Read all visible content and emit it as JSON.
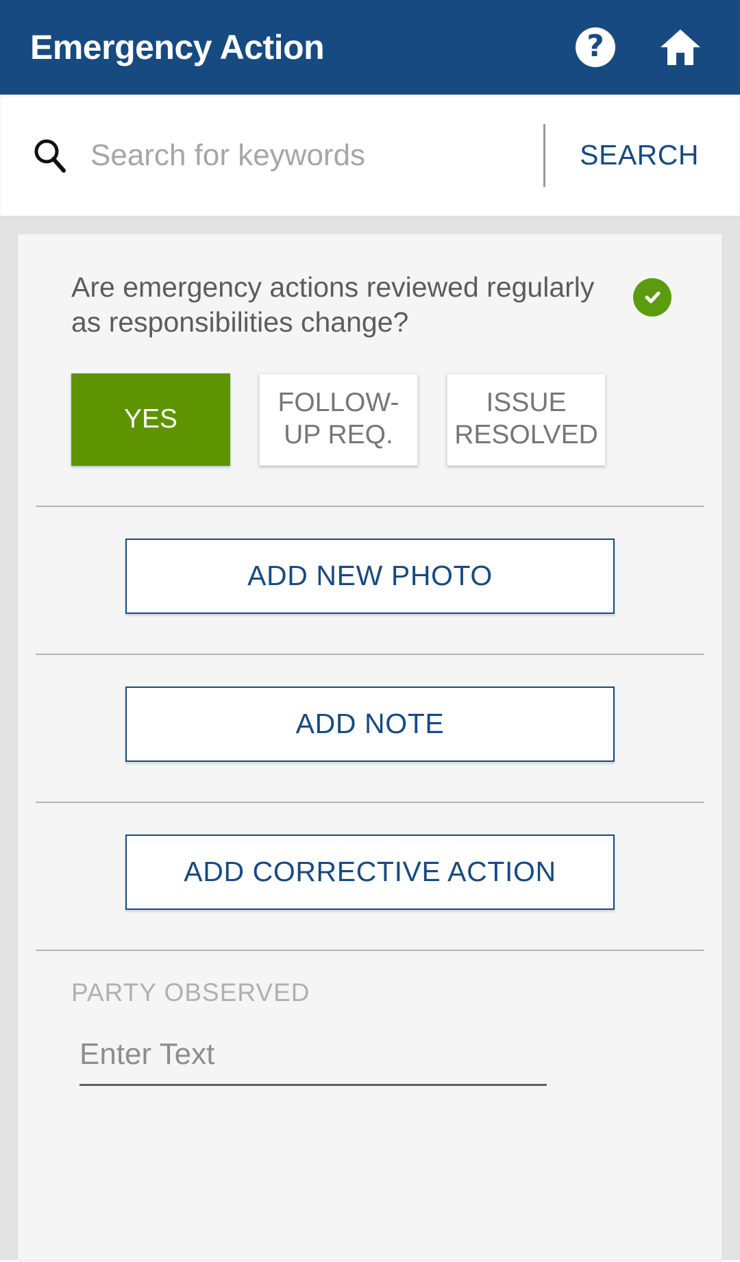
{
  "appbar": {
    "title": "Emergency Action",
    "help_icon": "help-circle-icon",
    "home_icon": "home-icon"
  },
  "search": {
    "icon": "search-icon",
    "placeholder": "Search for keywords",
    "value": "",
    "button_label": "SEARCH"
  },
  "card": {
    "question": "Are emergency actions reviewed regularly as responsibilities change?",
    "status_badge": {
      "icon": "check-icon",
      "color": "#5a9c0d"
    },
    "answers": [
      {
        "label": "YES",
        "selected": true
      },
      {
        "label": "FOLLOW-UP REQ.",
        "selected": false
      },
      {
        "label": "ISSUE RESOLVED",
        "selected": false
      }
    ],
    "actions": [
      {
        "label": "ADD NEW PHOTO"
      },
      {
        "label": "ADD NOTE"
      },
      {
        "label": "ADD CORRECTIVE ACTION"
      }
    ],
    "party_observed": {
      "label": "PARTY OBSERVED",
      "placeholder": "Enter Text",
      "value": ""
    }
  },
  "colors": {
    "brand_blue": "#174a81",
    "selected_green": "#5d9400",
    "badge_green": "#5a9c0d"
  }
}
